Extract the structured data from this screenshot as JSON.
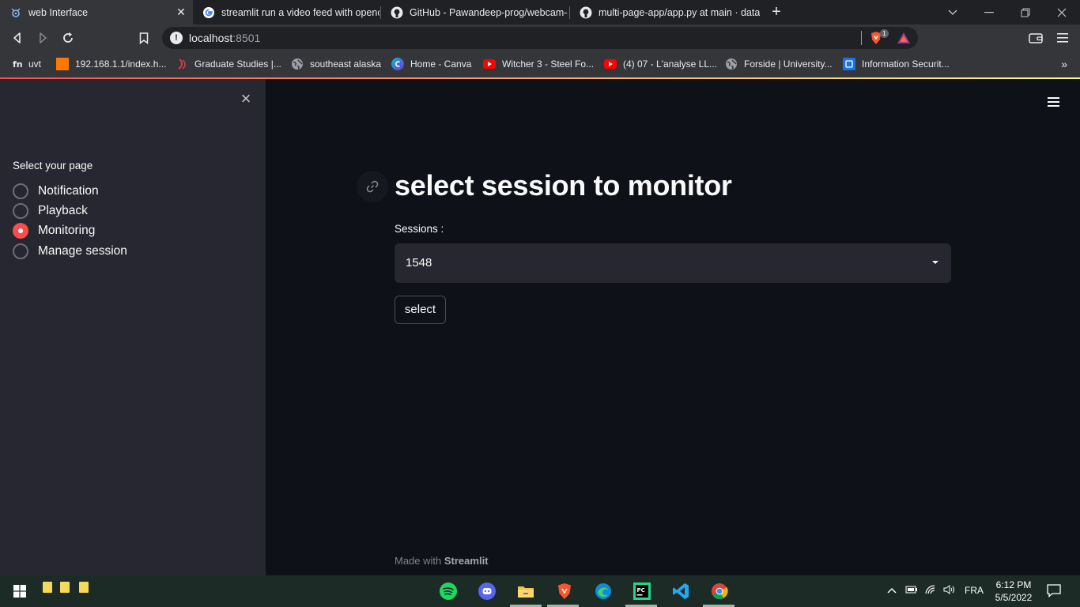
{
  "browser": {
    "tabs": [
      {
        "title": "web Interface",
        "active": true,
        "icon": "streamlit-icon"
      },
      {
        "title": "streamlit run a video feed with opencv",
        "icon": "google-icon"
      },
      {
        "title": "GitHub - Pawandeep-prog/webcam-st",
        "icon": "github-icon"
      },
      {
        "title": "multi-page-app/app.py at main · datap",
        "icon": "github-icon"
      }
    ],
    "url_host": "localhost",
    "url_port": ":8501",
    "brave_badge": "1",
    "bookmarks": [
      {
        "label": "uvt",
        "icon": "uvt-icon"
      },
      {
        "label": "192.168.1.1/index.h...",
        "icon": "orange-icon"
      },
      {
        "label": "Graduate Studies |...",
        "icon": "graduate-icon"
      },
      {
        "label": "southeast alaska",
        "icon": "globe-icon"
      },
      {
        "label": "Home - Canva",
        "icon": "canva-icon"
      },
      {
        "label": "Witcher 3 - Steel Fo...",
        "icon": "youtube-icon"
      },
      {
        "label": "(4) 07 - L'analyse LL...",
        "icon": "youtube-icon"
      },
      {
        "label": "Forside | University...",
        "icon": "globe-icon"
      },
      {
        "label": "Information Securit...",
        "icon": "infosec-icon"
      }
    ],
    "bookmarks_more": "»"
  },
  "sidebar": {
    "label": "Select your page",
    "options": [
      {
        "label": "Notification",
        "checked": false
      },
      {
        "label": "Playback",
        "checked": false
      },
      {
        "label": "Monitoring",
        "checked": true
      },
      {
        "label": "Manage session",
        "checked": false
      }
    ]
  },
  "main": {
    "title": "select session to monitor",
    "sessions_label": "Sessions :",
    "selected_session": "1548",
    "select_button": "select",
    "footer_prefix": "Made with ",
    "footer_brand": "Streamlit"
  },
  "taskbar": {
    "language": "FRA",
    "time": "6:12 PM",
    "date": "5/5/2022"
  },
  "colors": {
    "accent": "#ff4b4b",
    "sidebar_bg": "#262730",
    "main_bg": "#0e1117"
  }
}
